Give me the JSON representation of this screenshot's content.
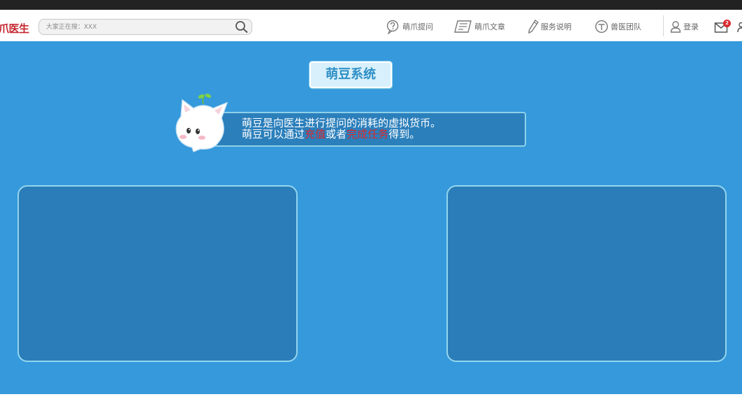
{
  "header": {
    "logo_text": "爪医生",
    "search": {
      "placeholder": "大家正在搜：XXX",
      "icon": "search-icon"
    },
    "nav": [
      {
        "label": "萌爪提问",
        "icon": "question-bubble-icon"
      },
      {
        "label": "萌爪文章",
        "icon": "article-icon"
      },
      {
        "label": "服务说明",
        "icon": "pencil-icon"
      },
      {
        "label": "兽医团队",
        "icon": "team-icon"
      }
    ],
    "login_label": "登录",
    "login_icon": "user-icon",
    "mail_icon": "mail-icon",
    "mail_badge": "2"
  },
  "hero": {
    "title": "萌豆系统",
    "desc_line1": "萌豆是向医生进行提问的消耗的虚拟货币。",
    "desc_line2_a": "萌豆可以通过",
    "desc_line2_link1": "充值",
    "desc_line2_b": "或者",
    "desc_line2_link2": "完成任务",
    "desc_line2_c": "得到。",
    "mascot_icon": "cat-mascot-icon"
  },
  "colors": {
    "brand_red": "#c4262e",
    "hero_bg": "#3599dc",
    "panel_bg": "#2a7db8",
    "panel_border": "#93d6ee",
    "highlight": "#d9282e"
  }
}
